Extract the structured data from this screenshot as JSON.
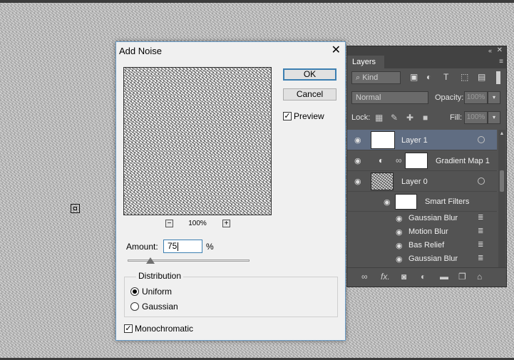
{
  "dialog": {
    "title": "Add Noise",
    "close_icon": "✕",
    "ok_label": "OK",
    "cancel_label": "Cancel",
    "preview_label": "Preview",
    "preview_checked": "✓",
    "zoom_level": "100%",
    "zoom_out_icon": "−",
    "zoom_in_icon": "+",
    "amount_label": "Amount:",
    "amount_value": "75",
    "percent_sign": "%",
    "distribution_title": "Distribution",
    "uniform_label": "Uniform",
    "gaussian_label": "Gaussian",
    "selected_distribution": "Uniform",
    "monochromatic_label": "Monochromatic",
    "monochromatic_checked": "✓"
  },
  "layers_panel": {
    "tab_label": "Layers",
    "collapse_icon": "«",
    "close_icon": "✕",
    "menu_icon": "≡",
    "kind_label": "⌕ Kind",
    "filter_icons": [
      "▣",
      "◐",
      "T",
      "⬚",
      "▤"
    ],
    "blend_mode": "Normal",
    "opacity_label": "Opacity:",
    "opacity_value": "100%",
    "lock_label": "Lock:",
    "lock_icons": [
      "▦",
      "✎",
      "✚",
      "■"
    ],
    "fill_label": "Fill:",
    "fill_value": "100%",
    "dropdown_icon": "▾",
    "eye_icon": "◉",
    "layers": [
      {
        "name": "Layer 1"
      },
      {
        "name": "Gradient Map 1"
      },
      {
        "name": "Layer 0"
      }
    ],
    "smart_filters_label": "Smart Filters",
    "filters": [
      "Gaussian Blur",
      "Motion Blur",
      "Bas Relief",
      "Gaussian Blur"
    ],
    "filter_options_icon": "≣",
    "bottom_icons": [
      "∞",
      "fx.",
      "◙",
      "◐",
      "▬",
      "❐",
      "⌂"
    ]
  },
  "colors": {
    "accent": "#3c7fb1",
    "panel_bg": "#535353",
    "selected_layer": "#606d82"
  }
}
